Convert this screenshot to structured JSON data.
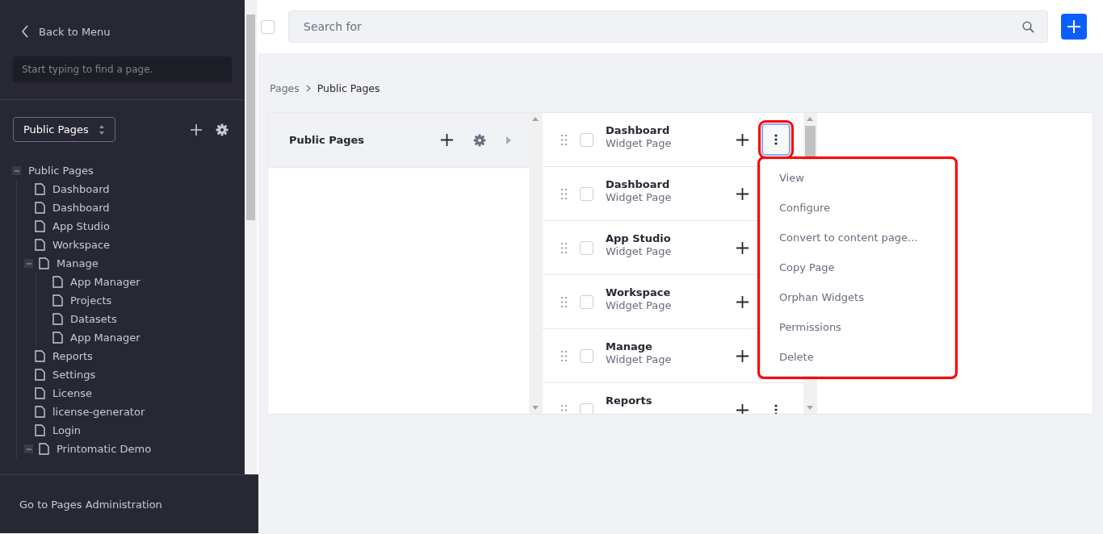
{
  "sidebar": {
    "back_link": "Back to Menu",
    "search": {
      "placeholder": "Start typing to find a page."
    },
    "site_selector": "Public Pages",
    "tree": [
      {
        "label": "Public Pages",
        "expanded": true,
        "children": [
          {
            "label": "Dashboard"
          },
          {
            "label": "Dashboard"
          },
          {
            "label": "App Studio"
          },
          {
            "label": "Workspace"
          },
          {
            "label": "Manage",
            "expanded": true,
            "children": [
              {
                "label": "App Manager"
              },
              {
                "label": "Projects"
              },
              {
                "label": "Datasets"
              },
              {
                "label": "App Manager"
              }
            ]
          },
          {
            "label": "Reports"
          },
          {
            "label": "Settings"
          },
          {
            "label": "License"
          },
          {
            "label": "license-generator"
          },
          {
            "label": "Login"
          },
          {
            "label": "Printomatic Demo",
            "expanded": true
          }
        ]
      }
    ],
    "footer_link": "Go to Pages Administration"
  },
  "toolbar": {
    "select_all": {
      "checked": false
    },
    "search": {
      "placeholder": "Search for"
    }
  },
  "breadcrumb": [
    "Pages",
    "Public Pages"
  ],
  "left_column": {
    "title": "Public Pages"
  },
  "pages": [
    {
      "title": "Dashboard",
      "subtitle": "Widget Page",
      "checked": false,
      "menu_open": true
    },
    {
      "title": "Dashboard",
      "subtitle": "Widget Page",
      "checked": false
    },
    {
      "title": "App Studio",
      "subtitle": "Widget Page",
      "checked": false
    },
    {
      "title": "Workspace",
      "subtitle": "Widget Page",
      "checked": false
    },
    {
      "title": "Manage",
      "subtitle": "Widget Page",
      "checked": false
    },
    {
      "title": "Reports",
      "checked": false
    }
  ],
  "action_menu": {
    "highlighted": true,
    "items": [
      "View",
      "Configure",
      "Convert to content page...",
      "Copy Page",
      "Orphan Widgets",
      "Permissions",
      "Delete"
    ]
  }
}
